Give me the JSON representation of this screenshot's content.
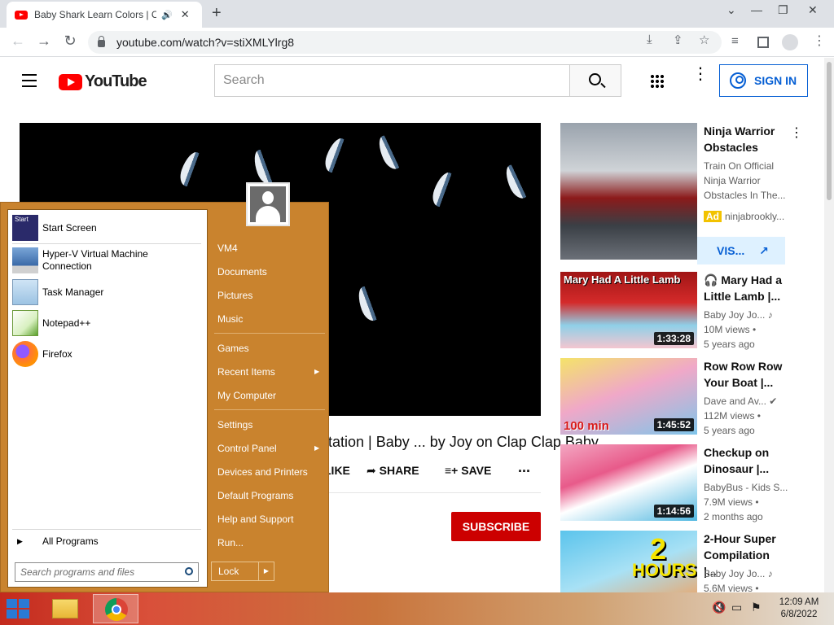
{
  "browser": {
    "tab_title": "Baby Shark Learn Colors | Co",
    "tab_speaker": "🔊",
    "tab_close": "✕",
    "new_tab": "+",
    "url": "youtube.com/watch?v=stiXMLYlrg8",
    "win_minimize": "⌄",
    "win_min2": "—",
    "win_restore": "❐",
    "win_close": "✕"
  },
  "youtube": {
    "logo_text": "YouTube",
    "search_placeholder": "Search",
    "signin_label": "SIGN IN",
    "video_title": "mploitation | Baby ... by Joy on Clap Clap Baby",
    "actions": {
      "like": "LIKE",
      "share": "SHARE",
      "save": "SAVE",
      "more": "..."
    },
    "subscribe_label": "SUBSCRIBE",
    "recommendations": [
      {
        "title": "Ninja Warrior Obstacles",
        "line1": "Train On Official",
        "line2": "Ninja Warrior",
        "line3": "Obstacles In The...",
        "ad_badge": "Ad",
        "channel": "ninjabrookly...",
        "cta": "VIS..."
      },
      {
        "title": "🎧 Mary Had a Little Lamb |...",
        "channel": "Baby Joy Jo... ♪",
        "views": "10M views •",
        "age": "5 years ago",
        "duration": "1:33:28",
        "thumb_text": "Mary Had A Little Lamb"
      },
      {
        "title": "Row Row Row Your Boat |...",
        "channel": "Dave and Av... ✔",
        "views": "112M views •",
        "age": "5 years ago",
        "duration": "1:45:52",
        "thumb_text": "100 min"
      },
      {
        "title": "Checkup on Dinosaur |...",
        "channel": "BabyBus - Kids S...",
        "views": "7.9M views •",
        "age": "2 months ago",
        "duration": "1:14:56"
      },
      {
        "title": "2-Hour Super Compilation |...",
        "channel": "Baby Joy Jo... ♪",
        "views": "5.6M views •",
        "thumb_text_big": "2",
        "thumb_text_small": "HOURS"
      }
    ]
  },
  "start_menu": {
    "left_items": [
      {
        "label": "Start Screen"
      },
      {
        "label": "Hyper-V Virtual Machine Connection"
      },
      {
        "label": "Task Manager"
      },
      {
        "label": "Notepad++"
      },
      {
        "label": "Firefox"
      }
    ],
    "start_tile_text": "Start",
    "all_programs": "All Programs",
    "search_placeholder": "Search programs and files",
    "right_items": [
      "VM4",
      "Documents",
      "Pictures",
      "Music",
      "Games",
      "Recent Items",
      "My Computer",
      "Settings",
      "Control Panel",
      "Devices and Printers",
      "Default Programs",
      "Help and Support",
      "Run..."
    ],
    "lock_label": "Lock"
  },
  "taskbar": {
    "time": "12:09 AM",
    "date": "6/8/2022"
  },
  "colors": {
    "start_menu_orange": "#c9832e",
    "youtube_red": "#ff0000",
    "subscribe_red": "#cc0000",
    "signin_blue": "#065fd4"
  }
}
